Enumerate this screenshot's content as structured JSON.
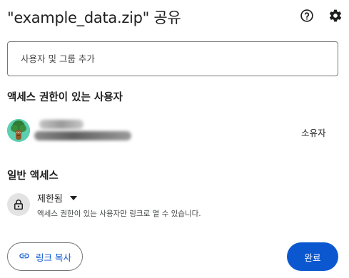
{
  "dialog": {
    "title": "\"example_data.zip\" 공유",
    "icons": {
      "help": "help-icon",
      "settings": "gear-icon"
    }
  },
  "add_people": {
    "placeholder": "사용자 및 그룹 추가"
  },
  "people_with_access": {
    "heading": "액세스 권한이 있는 사용자",
    "people": [
      {
        "avatar": "avatar-tree-character",
        "name": "",
        "email": "",
        "role": "소유자"
      }
    ]
  },
  "general_access": {
    "heading": "일반 액세스",
    "setting": "제한됨",
    "description": "액세스 권한이 있는 사용자만 링크로 열 수 있습니다.",
    "icons": {
      "lock": "lock-icon",
      "dropdown": "caret-down-icon"
    }
  },
  "footer": {
    "copy_link_label": "링크 복사",
    "done_label": "완료",
    "icons": {
      "link": "link-icon"
    }
  },
  "colors": {
    "accent": "#0b57d0",
    "text": "#1f1f1f",
    "border": "#747775"
  }
}
